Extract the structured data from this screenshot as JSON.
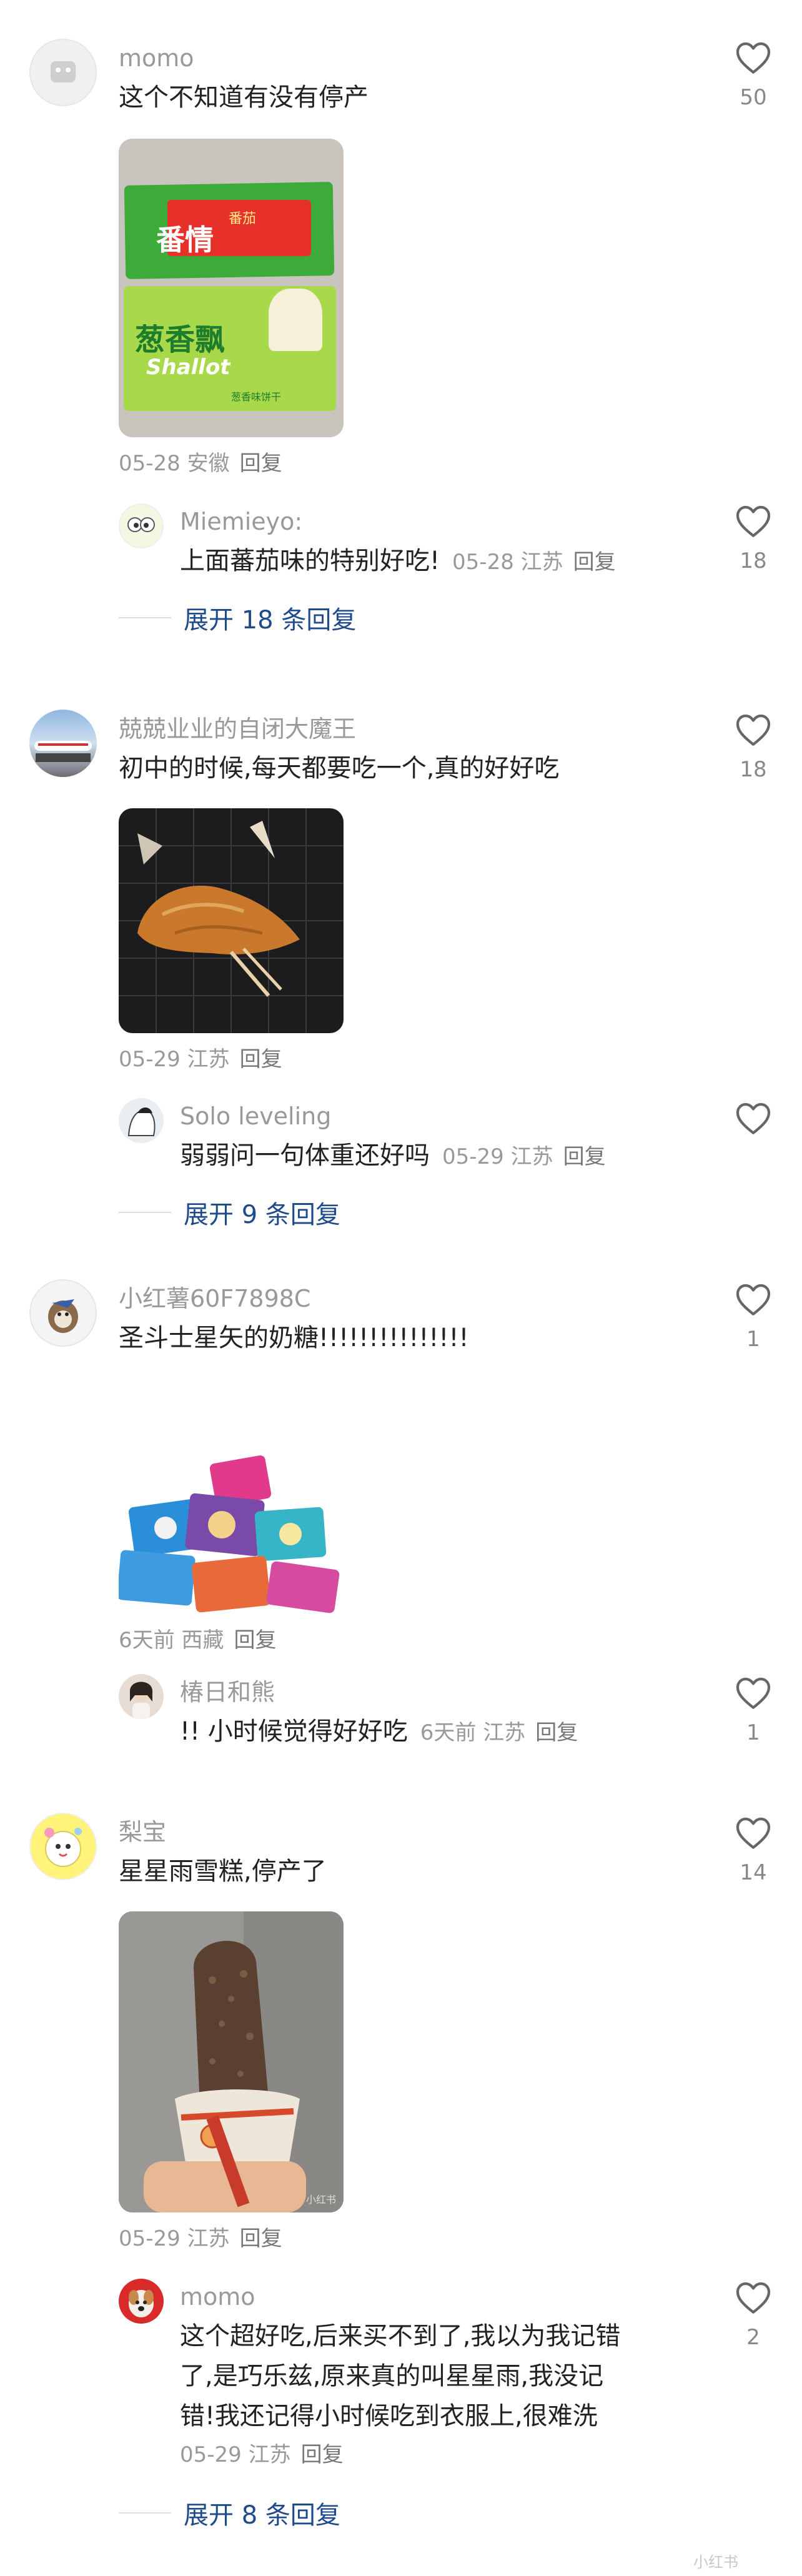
{
  "comments": [
    {
      "user": "momo",
      "text": "这个不知道有没有停产",
      "likes": "50",
      "date": "05-28",
      "location": "安徽",
      "reply_label": "回复",
      "image_text": [
        "番茄",
        "番情",
        "葱香飘",
        "Shallot",
        "葱香味饼干"
      ],
      "sub": {
        "user": "Miemieyo:",
        "text": "上面蕃茄味的特别好吃!",
        "date": "05-28",
        "location": "江苏",
        "reply_label": "回复",
        "likes": "18"
      },
      "expand": "展开 18 条回复"
    },
    {
      "user": "兢兢业业的自闭大魔王",
      "text": "初中的时候,每天都要吃一个,真的好好吃",
      "likes": "18",
      "date": "05-29",
      "location": "江苏",
      "reply_label": "回复",
      "sub": {
        "user": "Solo leveling",
        "text": "弱弱问一句体重还好吗",
        "date": "05-29",
        "location": "江苏",
        "reply_label": "回复",
        "likes": ""
      },
      "expand": "展开 9 条回复"
    },
    {
      "user": "小红薯60F7898C",
      "text": "圣斗士星矢的奶糖!!!!!!!!!!!!!!!",
      "likes": "1",
      "date": "6天前",
      "location": "西藏",
      "reply_label": "回复",
      "sub": {
        "user": "椿日和熊",
        "text": "!! 小时候觉得好好吃",
        "date": "6天前",
        "location": "江苏",
        "reply_label": "回复",
        "likes": "1"
      }
    },
    {
      "user": "梨宝",
      "text": "星星雨雪糕,停产了",
      "likes": "14",
      "date": "05-29",
      "location": "江苏",
      "reply_label": "回复",
      "sub": {
        "user": "momo",
        "text_lines": [
          "这个超好吃,后来买不到了,我以为我记错",
          "了,是巧乐兹,原来真的叫星星雨,我没记",
          "错!我还记得小时候吃到衣服上,很难洗"
        ],
        "date": "05-29",
        "location": "江苏",
        "reply_label": "回复",
        "likes": "2"
      },
      "expand": "展开 8 条回复"
    }
  ],
  "watermark": "小红书",
  "icons": {
    "like": "heart-outline-icon"
  },
  "colors": {
    "name": "#999999",
    "text": "#222222",
    "link": "#1f4b8c",
    "icon": "#666666"
  }
}
